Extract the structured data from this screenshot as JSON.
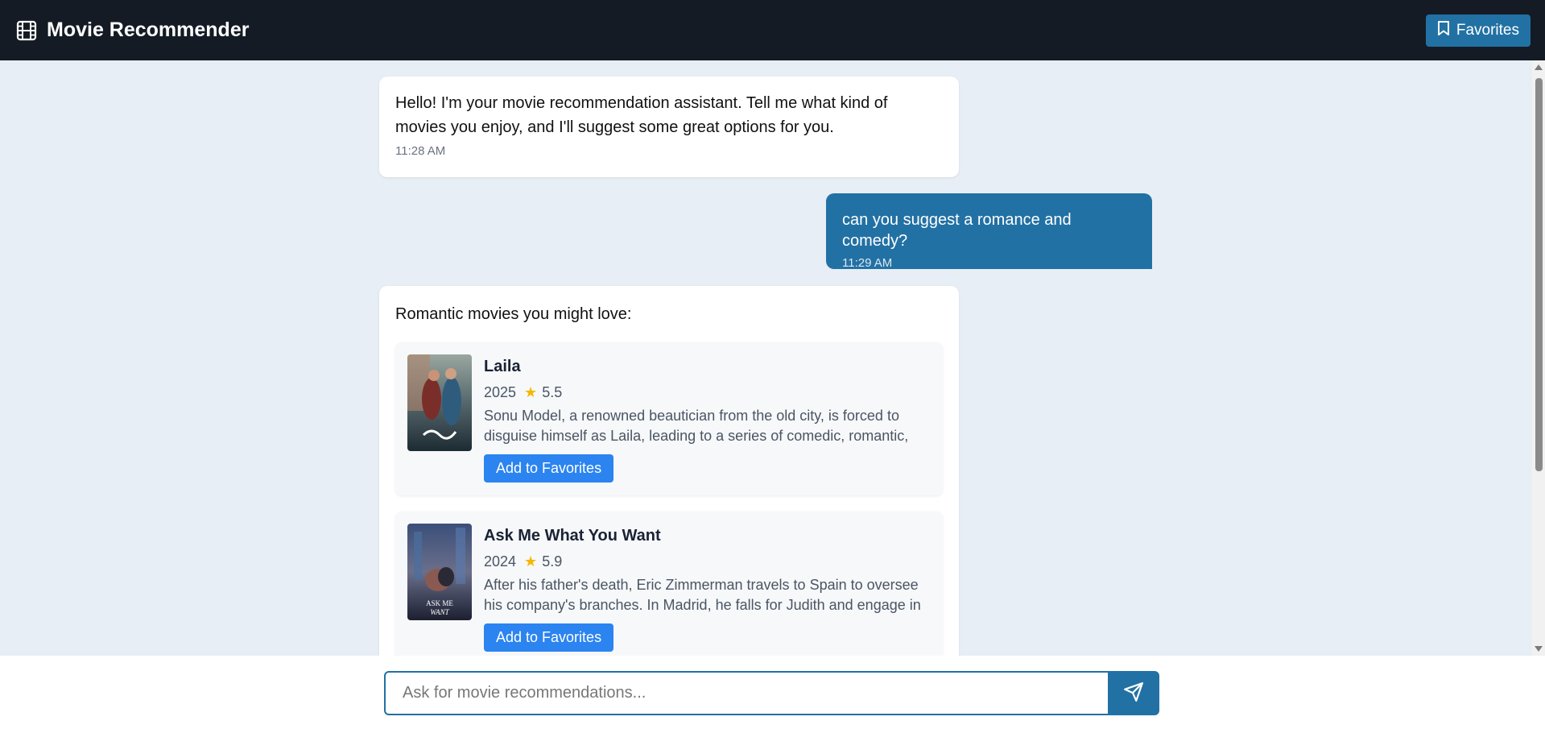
{
  "header": {
    "title": "Movie Recommender",
    "favorites_label": "Favorites",
    "brand_icon": "film-icon",
    "favorites_icon": "bookmark-icon"
  },
  "messages": [
    {
      "role": "assistant",
      "text": "Hello! I'm your movie recommendation assistant. Tell me what kind of movies you enjoy, and I'll suggest some great options for you.",
      "time": "11:28 AM"
    },
    {
      "role": "user",
      "text": "can you suggest a romance and comedy?",
      "time": "11:29 AM"
    },
    {
      "role": "assistant",
      "intro": "Romantic movies you might love:",
      "movies": [
        {
          "title": "Laila",
          "year": "2025",
          "rating": "5.5",
          "description": "Sonu Model, a renowned beautician from the old city, is forced to disguise himself as Laila, leading to a series of comedic, romantic, and…",
          "button": "Add to Favorites"
        },
        {
          "title": "Ask Me What You Want",
          "year": "2024",
          "rating": "5.9",
          "description": "After his father's death, Eric Zimmerman travels to Spain to oversee his company's branches. In Madrid, he falls for Judith and engage in an…",
          "button": "Add to Favorites"
        }
      ]
    }
  ],
  "input": {
    "placeholder": "Ask for movie recommendations...",
    "value": "",
    "send_icon": "send-icon"
  },
  "colors": {
    "header_bg": "#141b24",
    "accent": "#2271a4",
    "button": "#2b84f0",
    "star": "#f5b700"
  }
}
